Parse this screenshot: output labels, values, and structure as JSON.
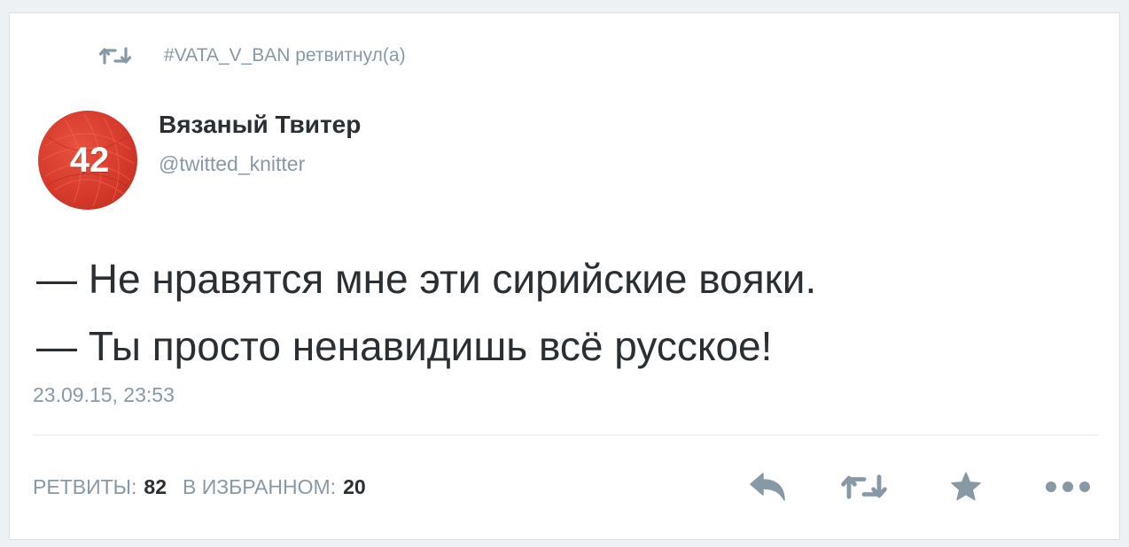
{
  "retweet_context": {
    "icon": "retweet-icon",
    "text": "#VATA_V_BAN ретвитнул(а)"
  },
  "author": {
    "avatar_text": "42",
    "avatar_color": "#d63a2a",
    "name": "Вязаный Твитер",
    "handle": "@twitted_knitter"
  },
  "tweet": {
    "line1": "— Не нравятся мне эти сирийские вояки.",
    "line2": "— Ты просто ненавидишь всё русское!",
    "timestamp": "23.09.15, 23:53"
  },
  "stats": {
    "retweets_label": "РЕТВИТЫ:",
    "retweets_count": "82",
    "favorites_label": "В ИЗБРАННОМ:",
    "favorites_count": "20"
  },
  "actions": {
    "icons": [
      "reply-icon",
      "retweet-icon",
      "star-icon",
      "more-icon"
    ],
    "icon_color": "#8899a6"
  }
}
